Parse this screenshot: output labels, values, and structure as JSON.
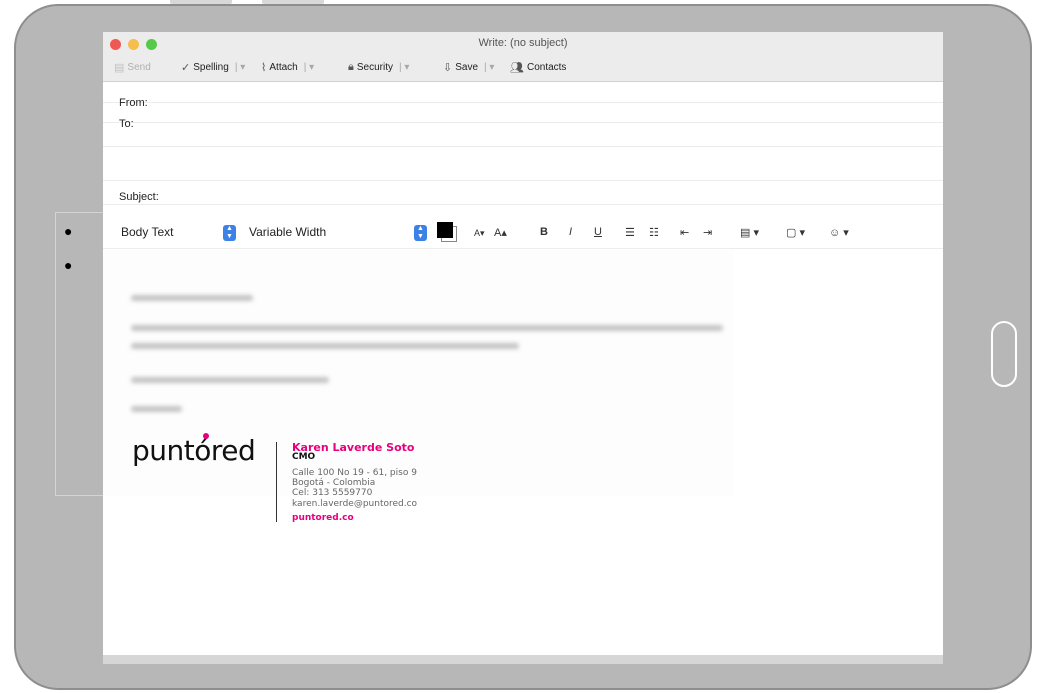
{
  "window": {
    "title": "Write: (no subject)"
  },
  "traffic_lights": {
    "close": "#ee5a52",
    "minimize": "#f5be4f",
    "zoom": "#58c84a"
  },
  "toolbar": {
    "send_label": "Send",
    "spelling_label": "Spelling",
    "attach_label": "Attach",
    "security_label": "Security",
    "save_label": "Save",
    "contacts_label": "Contacts"
  },
  "header": {
    "from_label": "From:",
    "to_label": "To:",
    "subject_label": "Subject:"
  },
  "format_bar": {
    "paragraph_style": "Body Text",
    "font": "Variable Width",
    "text_color": "#000000",
    "smaller_label": "A▾",
    "larger_label": "A▴",
    "bold_label": "B",
    "italic_label": "I",
    "underline_label": "U"
  },
  "signature": {
    "logo_text": "puntóred",
    "name": "Karen Laverde Soto",
    "role": "CMO",
    "address": "Calle 100 No 19 - 61, piso 9",
    "city": "Bogotá - Colombia",
    "phone": "Cel: 313 5559770",
    "email": "karen.laverde@puntored.co",
    "website": "puntored.co",
    "brand_color": "#e6007e"
  }
}
